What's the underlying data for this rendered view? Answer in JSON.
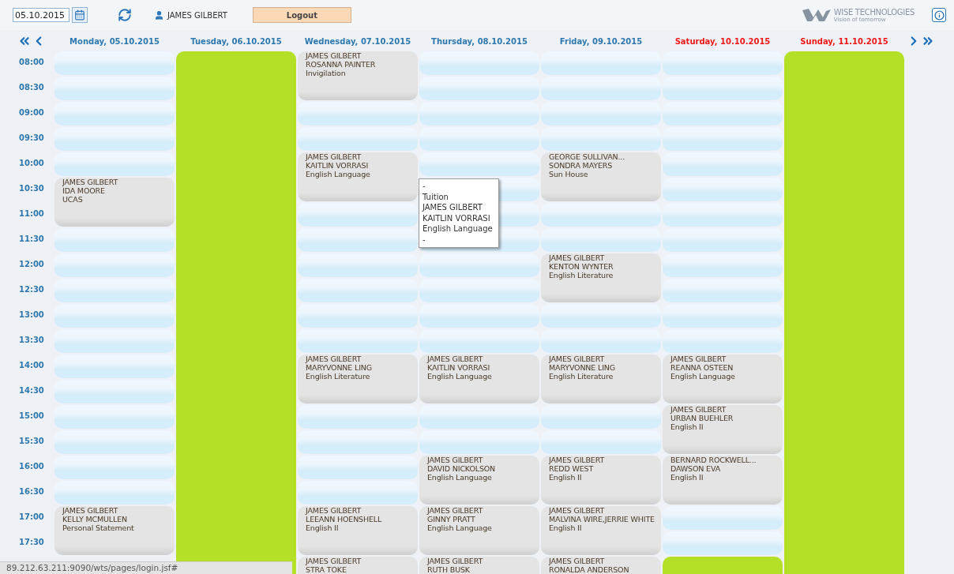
{
  "toolbar": {
    "date": "05.10.2015",
    "user": "JAMES GILBERT",
    "logout": "Logout",
    "logo": {
      "name": "WISE TECHNOLOGIES",
      "tagline": "Vision of tomorrow"
    }
  },
  "calendar": {
    "times": [
      "08:00",
      "08:30",
      "09:00",
      "09:30",
      "10:00",
      "10:30",
      "11:00",
      "11:30",
      "12:00",
      "12:30",
      "13:00",
      "13:30",
      "14:00",
      "14:30",
      "15:00",
      "15:30",
      "16:00",
      "16:30",
      "17:00",
      "17:30"
    ],
    "days": [
      {
        "label": "Monday, 05.10.2015",
        "weekend": false,
        "blocks": [
          {
            "kind": "free"
          },
          {
            "kind": "free"
          },
          {
            "kind": "free"
          },
          {
            "kind": "free"
          },
          {
            "kind": "free"
          },
          {
            "kind": "event",
            "lines": [
              "JAMES GILBERT",
              "IDA MOORE",
              "UCAS"
            ]
          },
          {
            "kind": "free"
          },
          {
            "kind": "free"
          },
          {
            "kind": "free"
          },
          {
            "kind": "free"
          },
          {
            "kind": "free"
          },
          {
            "kind": "free"
          },
          {
            "kind": "free"
          },
          {
            "kind": "free"
          },
          {
            "kind": "free"
          },
          {
            "kind": "free"
          },
          {
            "kind": "free"
          },
          {
            "kind": "event",
            "lines": [
              "JAMES GILBERT",
              "KELLY MCMULLEN",
              "Personal Statement"
            ]
          }
        ]
      },
      {
        "label": "Tuesday, 06.10.2015",
        "weekend": false,
        "blocks": [
          {
            "kind": "closed"
          }
        ]
      },
      {
        "label": "Wednesday, 07.10.2015",
        "weekend": false,
        "blocks": [
          {
            "kind": "event",
            "lines": [
              "JAMES GILBERT",
              "ROSANNA PAINTER",
              "Invigilation"
            ]
          },
          {
            "kind": "free"
          },
          {
            "kind": "free"
          },
          {
            "kind": "event",
            "lines": [
              "JAMES GILBERT",
              "KAITLIN VORRASI",
              "English Language"
            ]
          },
          {
            "kind": "free"
          },
          {
            "kind": "free"
          },
          {
            "kind": "free"
          },
          {
            "kind": "free"
          },
          {
            "kind": "free"
          },
          {
            "kind": "free"
          },
          {
            "kind": "event",
            "lines": [
              "JAMES GILBERT",
              "MARYVONNE LING",
              "English Literature"
            ]
          },
          {
            "kind": "free"
          },
          {
            "kind": "free"
          },
          {
            "kind": "free"
          },
          {
            "kind": "free"
          },
          {
            "kind": "event",
            "lines": [
              "JAMES GILBERT",
              "LEEANN HOENSHELL",
              "English II"
            ]
          },
          {
            "kind": "event",
            "lines": [
              "JAMES GILBERT",
              "STRA TOKE"
            ]
          }
        ]
      },
      {
        "label": "Thursday, 08.10.2015",
        "weekend": false,
        "blocks": [
          {
            "kind": "free"
          },
          {
            "kind": "free"
          },
          {
            "kind": "free"
          },
          {
            "kind": "free"
          },
          {
            "kind": "free"
          },
          {
            "kind": "free"
          },
          {
            "kind": "free"
          },
          {
            "kind": "free"
          },
          {
            "kind": "free"
          },
          {
            "kind": "free"
          },
          {
            "kind": "free"
          },
          {
            "kind": "free"
          },
          {
            "kind": "event",
            "lines": [
              "JAMES GILBERT",
              "KAITLIN VORRASI",
              "English Language"
            ]
          },
          {
            "kind": "free"
          },
          {
            "kind": "free"
          },
          {
            "kind": "event",
            "lines": [
              "JAMES GILBERT",
              "DAVID NICKOLSON",
              "English Language"
            ]
          },
          {
            "kind": "event",
            "lines": [
              "JAMES GILBERT",
              "GINNY PRATT",
              "English Language"
            ]
          },
          {
            "kind": "event",
            "lines": [
              "JAMES GILBERT",
              "RUTH BUSK"
            ]
          }
        ]
      },
      {
        "label": "Friday, 09.10.2015",
        "weekend": false,
        "blocks": [
          {
            "kind": "free"
          },
          {
            "kind": "free"
          },
          {
            "kind": "free"
          },
          {
            "kind": "free"
          },
          {
            "kind": "event",
            "lines": [
              "GEORGE SULLIVAN...",
              "SONDRA MAYERS",
              "Sun House"
            ]
          },
          {
            "kind": "free"
          },
          {
            "kind": "free"
          },
          {
            "kind": "event",
            "lines": [
              "JAMES GILBERT",
              "KENTON WYNTER",
              "English Literature"
            ]
          },
          {
            "kind": "free"
          },
          {
            "kind": "free"
          },
          {
            "kind": "event",
            "lines": [
              "JAMES GILBERT",
              "MARYVONNE LING",
              "English Literature"
            ]
          },
          {
            "kind": "free"
          },
          {
            "kind": "free"
          },
          {
            "kind": "event",
            "lines": [
              "JAMES GILBERT",
              "REDD WEST",
              "English II"
            ]
          },
          {
            "kind": "event",
            "lines": [
              "JAMES GILBERT",
              "MALVINA WIRE,JERRIE WHITE",
              "English II"
            ]
          },
          {
            "kind": "event",
            "lines": [
              "JAMES GILBERT",
              "RONALDA ANDERSON"
            ]
          }
        ]
      },
      {
        "label": "Saturday, 10.10.2015",
        "weekend": true,
        "blocks": [
          {
            "kind": "free"
          },
          {
            "kind": "free"
          },
          {
            "kind": "free"
          },
          {
            "kind": "free"
          },
          {
            "kind": "free"
          },
          {
            "kind": "free"
          },
          {
            "kind": "free"
          },
          {
            "kind": "free"
          },
          {
            "kind": "free"
          },
          {
            "kind": "free"
          },
          {
            "kind": "free"
          },
          {
            "kind": "free"
          },
          {
            "kind": "event",
            "lines": [
              "JAMES GILBERT",
              "REANNA OSTEEN",
              "English Language"
            ]
          },
          {
            "kind": "event",
            "lines": [
              "JAMES GILBERT",
              "URBAN BUEHLER",
              "English II"
            ]
          },
          {
            "kind": "event",
            "lines": [
              "BERNARD ROCKWELL...",
              "DAWSON EVA",
              "English II"
            ]
          },
          {
            "kind": "free"
          },
          {
            "kind": "free"
          },
          {
            "kind": "closed"
          }
        ]
      },
      {
        "label": "Sunday, 11.10.2015",
        "weekend": true,
        "blocks": [
          {
            "kind": "closed"
          }
        ]
      }
    ]
  },
  "tooltip": {
    "lines": [
      "-",
      "Tuition",
      "JAMES GILBERT",
      "KAITLIN VORRASI",
      "English Language",
      "-"
    ]
  },
  "status_bar": "89.212.63.211:9090/wts/pages/login.jsf#"
}
